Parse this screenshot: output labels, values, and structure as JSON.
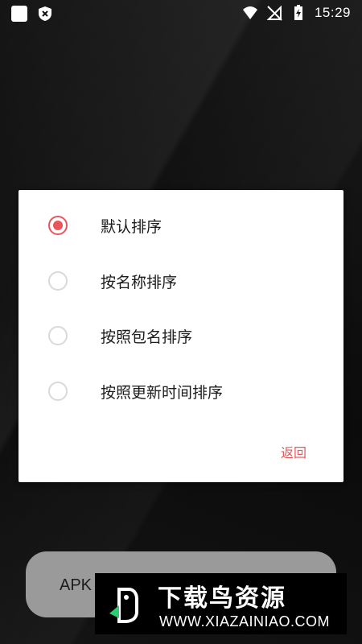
{
  "status_bar": {
    "time": "15:29",
    "icons": [
      "notification-square-icon",
      "shield-icon",
      "wifi-icon",
      "no-sim-icon",
      "battery-charging-icon"
    ]
  },
  "dialog": {
    "options": [
      {
        "label": "默认排序",
        "selected": true
      },
      {
        "label": "按名称排序",
        "selected": false
      },
      {
        "label": "按照包名排序",
        "selected": false
      },
      {
        "label": "按照更新时间排序",
        "selected": false
      }
    ],
    "back_label": "返回",
    "accent_color": "#e8565a"
  },
  "background_button": {
    "label": "APK"
  },
  "watermark": {
    "title": "下载鸟资源",
    "url": "WWW.XIAZAINIAO.COM"
  }
}
